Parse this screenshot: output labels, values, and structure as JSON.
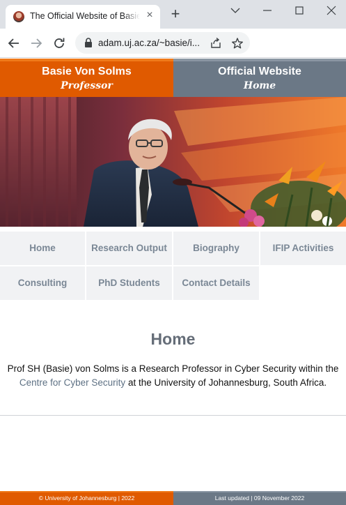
{
  "browser": {
    "tab_title": "The Official Website of Basie Von Solms",
    "url": "adam.uj.ac.za/~basie/i..."
  },
  "header": {
    "left_title": "Basie Von Solms",
    "left_subtitle": "Professor",
    "right_title": "Official Website",
    "right_subtitle": "Home"
  },
  "menu": {
    "items": [
      {
        "label": "Home"
      },
      {
        "label": "Research Output"
      },
      {
        "label": "Biography"
      },
      {
        "label": "IFIP Activities"
      },
      {
        "label": "Consulting"
      },
      {
        "label": "PhD Students"
      },
      {
        "label": "Contact Details"
      }
    ]
  },
  "content": {
    "title": "Home",
    "text_before": "Prof SH (Basie) von Solms is a Research Professor in Cyber Security within the ",
    "link_text": "Centre for Cyber Security",
    "text_after": " at the University of Johannesburg, South Africa."
  },
  "footer": {
    "left": "© University of Johannesburg | 2022",
    "right": "Last updated | 09 November 2022"
  },
  "colors": {
    "orange": "#e05a00",
    "slate": "#6b7886",
    "menu_bg": "#f1f2f4",
    "menu_text": "#7a8795"
  },
  "icons": [
    "favicon-icon",
    "close-icon",
    "plus-icon",
    "chevron-down-icon",
    "minimize-icon",
    "maximize-icon",
    "window-close-icon",
    "back-arrow-icon",
    "forward-arrow-icon",
    "reload-icon",
    "lock-icon",
    "share-icon",
    "star-icon"
  ]
}
